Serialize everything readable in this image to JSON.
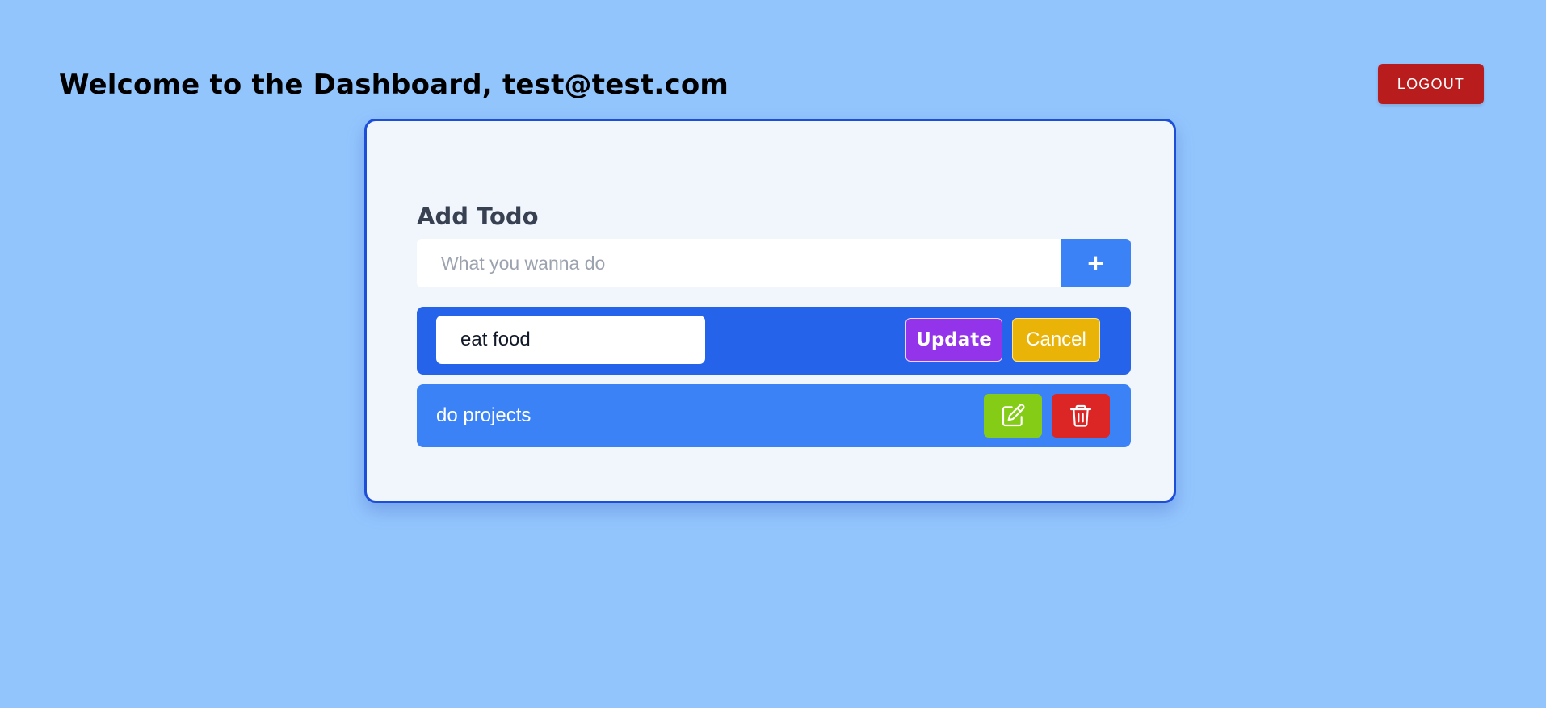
{
  "header": {
    "title": "Welcome to the Dashboard, test@test.com",
    "logout_label": "LOGOUT"
  },
  "add_todo": {
    "label": "Add Todo",
    "placeholder": "What you wanna do",
    "value": "",
    "add_button_label": "+"
  },
  "editing": {
    "value": "eat food",
    "update_label": "Update",
    "cancel_label": "Cancel"
  },
  "todos": [
    {
      "text": "do projects",
      "edit_icon": "pencil-square-icon",
      "delete_icon": "trash-icon"
    }
  ],
  "colors": {
    "background": "#93c5fd",
    "card_background": "#f1f6fd",
    "card_border": "#1d4ed8",
    "logout": "#b91c1c",
    "add_button": "#3b82f6",
    "edit_row": "#2563eb",
    "todo_item": "#3b82f6",
    "update": "#9333ea",
    "cancel": "#eab308",
    "edit": "#84cc16",
    "delete": "#dc2626"
  }
}
